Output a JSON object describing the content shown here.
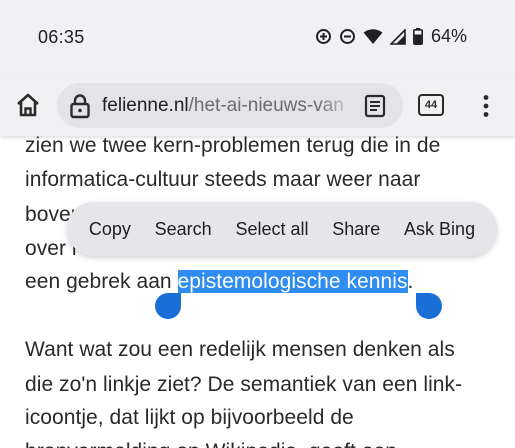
{
  "status_bar": {
    "time": "06:35",
    "battery": "64%"
  },
  "toolbar": {
    "url_domain": "felienne.nl",
    "url_path": "/het-ai-nieuws-van",
    "tab_count": "44"
  },
  "article": {
    "lines": [
      "zien we twee kern-problemen terug die in de",
      "informatica-cultuur steeds maar weer naar",
      "boven",
      "over l",
      "een gebrek aan ",
      "epistemologische kennis",
      ".",
      "Want wat zou een redelijk mensen denken als",
      "die zo'n linkje ziet? De semantiek van een link-",
      "icoontje, dat lijkt op bijvoorbeeld de",
      "bronvermelding op Wikipedia, geeft een"
    ]
  },
  "context_menu": {
    "items": [
      "Copy",
      "Search",
      "Select all",
      "Share",
      "Ask Bing"
    ]
  },
  "colors": {
    "selection": "#2f8cf0",
    "handle": "#1a6fd6",
    "chrome_bg": "#f1f1f4"
  }
}
